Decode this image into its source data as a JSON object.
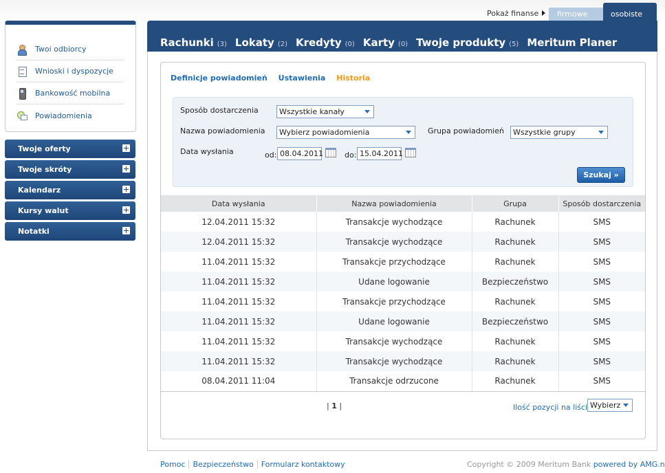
{
  "top": {
    "show_finance": "Pokaż finanse",
    "tab_business": "firmowe",
    "tab_personal": "osobiste"
  },
  "sidebar": {
    "links": [
      {
        "label": "Twoi odbiorcy",
        "icon": "person-icon"
      },
      {
        "label": "Wnioski i dyspozycje",
        "icon": "document-icon"
      },
      {
        "label": "Bankowość mobilna",
        "icon": "phone-icon"
      },
      {
        "label": "Powiadomienia",
        "icon": "notification-icon"
      }
    ],
    "accordions": [
      "Twoje oferty",
      "Twoje skróty",
      "Kalendarz",
      "Kursy walut",
      "Notatki"
    ]
  },
  "nav": [
    {
      "label": "Rachunki",
      "count": "(3)"
    },
    {
      "label": "Lokaty",
      "count": "(2)"
    },
    {
      "label": "Kredyty",
      "count": "(0)"
    },
    {
      "label": "Karty",
      "count": "(0)"
    },
    {
      "label": "Twoje produkty",
      "count": "(5)"
    },
    {
      "label": "Meritum Planer",
      "count": ""
    }
  ],
  "subtabs": [
    {
      "label": "Definicje powiadomień",
      "active": false
    },
    {
      "label": "Ustawienia",
      "active": false
    },
    {
      "label": "Historia",
      "active": true
    }
  ],
  "filter": {
    "delivery_label": "Sposób dostarczenia",
    "delivery_value": "Wszystkie kanały",
    "name_label": "Nazwa powiadomienia",
    "name_value": "Wybierz powiadomienia",
    "group_label": "Grupa powiadomień",
    "group_value": "Wszystkie grupy",
    "date_label": "Data wysłania",
    "from_label": "od:",
    "from_value": "08.04.2011",
    "to_label": "do:",
    "to_value": "15.04.2011",
    "search_label": "Szukaj »"
  },
  "table": {
    "headers": [
      "Data wysłania",
      "Nazwa powiadomienia",
      "Grupa",
      "Sposób dostarczenia"
    ],
    "rows": [
      [
        "12.04.2011 15:32",
        "Transakcje wychodzące",
        "Rachunek",
        "SMS"
      ],
      [
        "12.04.2011 15:32",
        "Transakcje wychodzące",
        "Rachunek",
        "SMS"
      ],
      [
        "11.04.2011 15:32",
        "Transakcje przychodzące",
        "Rachunek",
        "SMS"
      ],
      [
        "11.04.2011 15:32",
        "Udane logowanie",
        "Bezpieczeństwo",
        "SMS"
      ],
      [
        "11.04.2011 15:32",
        "Transakcje przychodzące",
        "Rachunek",
        "SMS"
      ],
      [
        "11.04.2011 15:32",
        "Udane logowanie",
        "Bezpieczeństwo",
        "SMS"
      ],
      [
        "11.04.2011 15:32",
        "Transakcje wychodzące",
        "Rachunek",
        "SMS"
      ],
      [
        "11.04.2011 15:32",
        "Transakcje wychodzące",
        "Rachunek",
        "SMS"
      ],
      [
        "08.04.2011 11:04",
        "Transakcje odrzucone",
        "Rachunek",
        "SMS"
      ]
    ]
  },
  "pager": {
    "left": "|",
    "page": "1",
    "right": "|",
    "per_page_label": "Ilość pozycji na liście",
    "per_page_value": "Wybierz"
  },
  "footer": {
    "links": [
      "Pomoc",
      "Bezpieczeństwo",
      "Formularz kontaktowy"
    ],
    "copyright": "Copyright © 2009 Meritum Bank",
    "powered": "powered by AMG.net"
  },
  "colors": {
    "brand_navy": "#244c7c",
    "link_blue": "#1f6cb5",
    "active_orange": "#f19a14"
  }
}
